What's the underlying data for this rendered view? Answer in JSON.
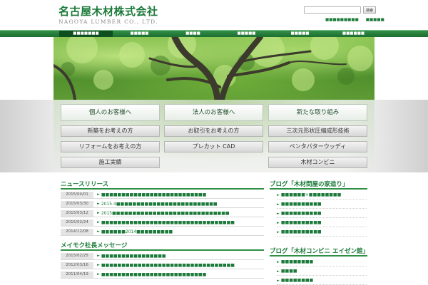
{
  "header": {
    "logo_jp": "名古屋木材株式会社",
    "logo_en": "NAGOYA LUMBER CO., LTD.",
    "search_placeholder": "",
    "search_button": "検索",
    "util_links": [
      "■■■■■■■■■",
      "■■■■■"
    ]
  },
  "nav": {
    "items": [
      {
        "label": "■■■■■■■",
        "active": true
      },
      {
        "label": "■■■■■",
        "active": false
      },
      {
        "label": "■■■■",
        "active": false
      },
      {
        "label": "■■■■■",
        "active": false
      },
      {
        "label": "■■■■■",
        "active": false
      },
      {
        "label": "■■■■■■",
        "active": false
      }
    ]
  },
  "banners": {
    "col1": {
      "main": "個人のお客様へ",
      "subs": [
        "新築をお考えの方",
        "リフォームをお考えの方",
        "施工実績"
      ]
    },
    "col2": {
      "main": "法人のお客様へ",
      "subs": [
        "お取引をお考えの方",
        "プレカット CAD"
      ]
    },
    "col3": {
      "main": "新たな取り組み",
      "subs": [
        "三次元形状圧縮成形技術",
        "ペンタパターウッディ",
        "木材コンビニ"
      ]
    }
  },
  "news": {
    "title": "ニュースリリース",
    "rows": [
      {
        "date": "2015/04/01",
        "text": "■■■■■■■■■■■■■■■■■■■■■■■■■■"
      },
      {
        "date": "2015/03/30",
        "text": "2015.4■■■■■■■■■■■■■■■■■■■■■■■■■"
      },
      {
        "date": "2015/03/12",
        "text": "2015■■■■■■■■■■■■■■■■■■■■■■■■■■■■■"
      },
      {
        "date": "2015/02/24",
        "text": "■■■■■■■■■■■■■■■■■■■■■■■■■■■■■■■■■"
      },
      {
        "date": "2014/12/08",
        "text": "■■■■■■2014■■■■■■■■■"
      }
    ]
  },
  "message": {
    "title": "メイモク社長メッセージ",
    "rows": [
      {
        "date": "2015/02/25",
        "text": "■■■■■■■■■■■■■■■■"
      },
      {
        "date": "2012/03/16",
        "text": "■■■■■■■■■■■■■■■■■■■■■■■■■■■■■■■■■"
      },
      {
        "date": "2011/04/19",
        "text": "■■■■■■■■■■■■■■■■■■■■■■■■■■"
      }
    ]
  },
  "blog1": {
    "title": "ブログ「木材問屋の家造り」",
    "items": [
      "■■■■■■×■■■■■■■■",
      "■■■■■■■■■■",
      "■■■■■■■■■■",
      "■■■■■■■■■■",
      "■■■■■■■■■■"
    ]
  },
  "blog2": {
    "title": "ブログ「木材コンビニ エイゼン館」",
    "items": [
      "■■■■■■■■",
      "■■■■",
      "■■■■■■■■"
    ]
  },
  "colors": {
    "brand": "#1c7a3a",
    "nav": "#2f8f45",
    "nav_active": "#0e4f1f"
  }
}
